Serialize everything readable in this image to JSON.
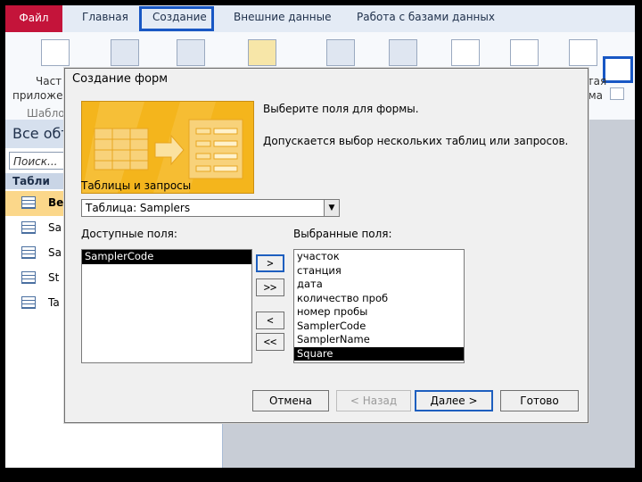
{
  "ribbon": {
    "tabs": [
      "Файл",
      "Главная",
      "Создание",
      "Внешние данные",
      "Работа с базами данных"
    ],
    "left_text": [
      "Част",
      "приложе",
      "Шабло"
    ],
    "right_text": [
      "стая",
      "рма"
    ]
  },
  "nav": {
    "header": "Все объ",
    "search_placeholder": "Поиск...",
    "section": "Табли",
    "items": [
      "Ве",
      "Sa",
      "Sa",
      "St",
      "Ta"
    ]
  },
  "dialog": {
    "title": "Создание форм",
    "instruction1": "Выберите поля для формы.",
    "instruction2": "Допускается выбор нескольких таблиц или запросов.",
    "tables_label": "Таблицы и запросы",
    "tables_value": "Таблица: Samplers",
    "available_label": "Доступные поля:",
    "selected_label": "Выбранные поля:",
    "available_fields": [
      "SamplerCode"
    ],
    "selected_fields": [
      "участок",
      "станция",
      "дата",
      "количество проб",
      "номер пробы",
      "SamplerCode",
      "SamplerName",
      "Square"
    ],
    "move_buttons": [
      ">",
      ">>",
      "<",
      "<<"
    ],
    "buttons": {
      "cancel": "Отмена",
      "back": "< Назад",
      "next": "Далее >",
      "finish": "Готово"
    }
  },
  "colors": {
    "accent_blue": "#1857c4",
    "file_tab": "#c4143a",
    "selected_nav": "#fbd78a"
  }
}
